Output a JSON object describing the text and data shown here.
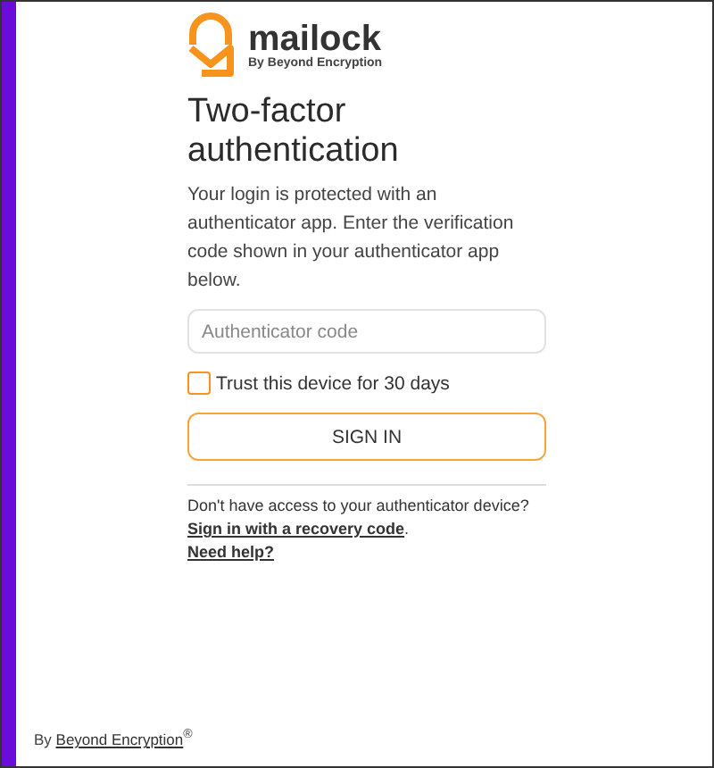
{
  "logo": {
    "name": "mailock",
    "tagline": "By Beyond Encryption"
  },
  "title": "Two-factor authentication",
  "intro": "Your login is protected with an authenticator app. Enter the verification code shown in your authenticator app below.",
  "code_field": {
    "placeholder": "Authenticator code"
  },
  "trust_device": {
    "label": "Trust this device for 30 days",
    "checked": false
  },
  "submit": "SIGN IN",
  "help": {
    "question": "Don't have access to your authenticator device?",
    "recovery_link": "Sign in with a recovery code",
    "recovery_suffix": ".",
    "help_link": "Need help?"
  },
  "footer": {
    "prefix": "By ",
    "link": "Beyond Encryption",
    "suffix": "$^{®}$"
  }
}
